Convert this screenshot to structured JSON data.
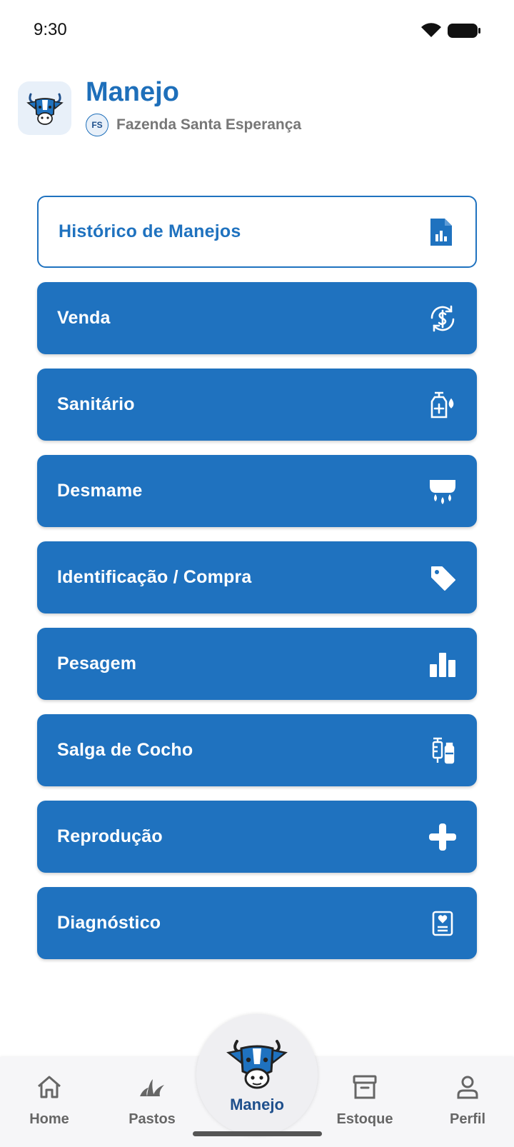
{
  "status_bar": {
    "time": "9:30"
  },
  "header": {
    "title": "Manejo",
    "farm_initials": "FS",
    "farm_name": "Fazenda Santa Esperança"
  },
  "menu": [
    {
      "label": "Histórico de Manejos",
      "icon": "report-document-icon",
      "style": "outline"
    },
    {
      "label": "Venda",
      "icon": "dollar-sync-icon",
      "style": "filled"
    },
    {
      "label": "Sanitário",
      "icon": "sanitizer-bottle-icon",
      "style": "filled"
    },
    {
      "label": "Desmame",
      "icon": "udder-milk-icon",
      "style": "filled"
    },
    {
      "label": "Identificação / Compra",
      "icon": "tag-icon",
      "style": "filled"
    },
    {
      "label": "Pesagem",
      "icon": "bar-chart-icon",
      "style": "filled"
    },
    {
      "label": "Salga de Cocho",
      "icon": "vaccine-vial-icon",
      "style": "filled"
    },
    {
      "label": "Reprodução",
      "icon": "plus-icon",
      "style": "filled"
    },
    {
      "label": "Diagnóstico",
      "icon": "medical-record-icon",
      "style": "filled"
    }
  ],
  "bottom_nav": {
    "home": "Home",
    "pastos": "Pastos",
    "manejo": "Manejo",
    "estoque": "Estoque",
    "perfil": "Perfil"
  },
  "colors": {
    "primary": "#1f72bf",
    "title": "#1e6fba",
    "nav_active": "#1e4f8c",
    "nav_inactive": "#666666"
  }
}
